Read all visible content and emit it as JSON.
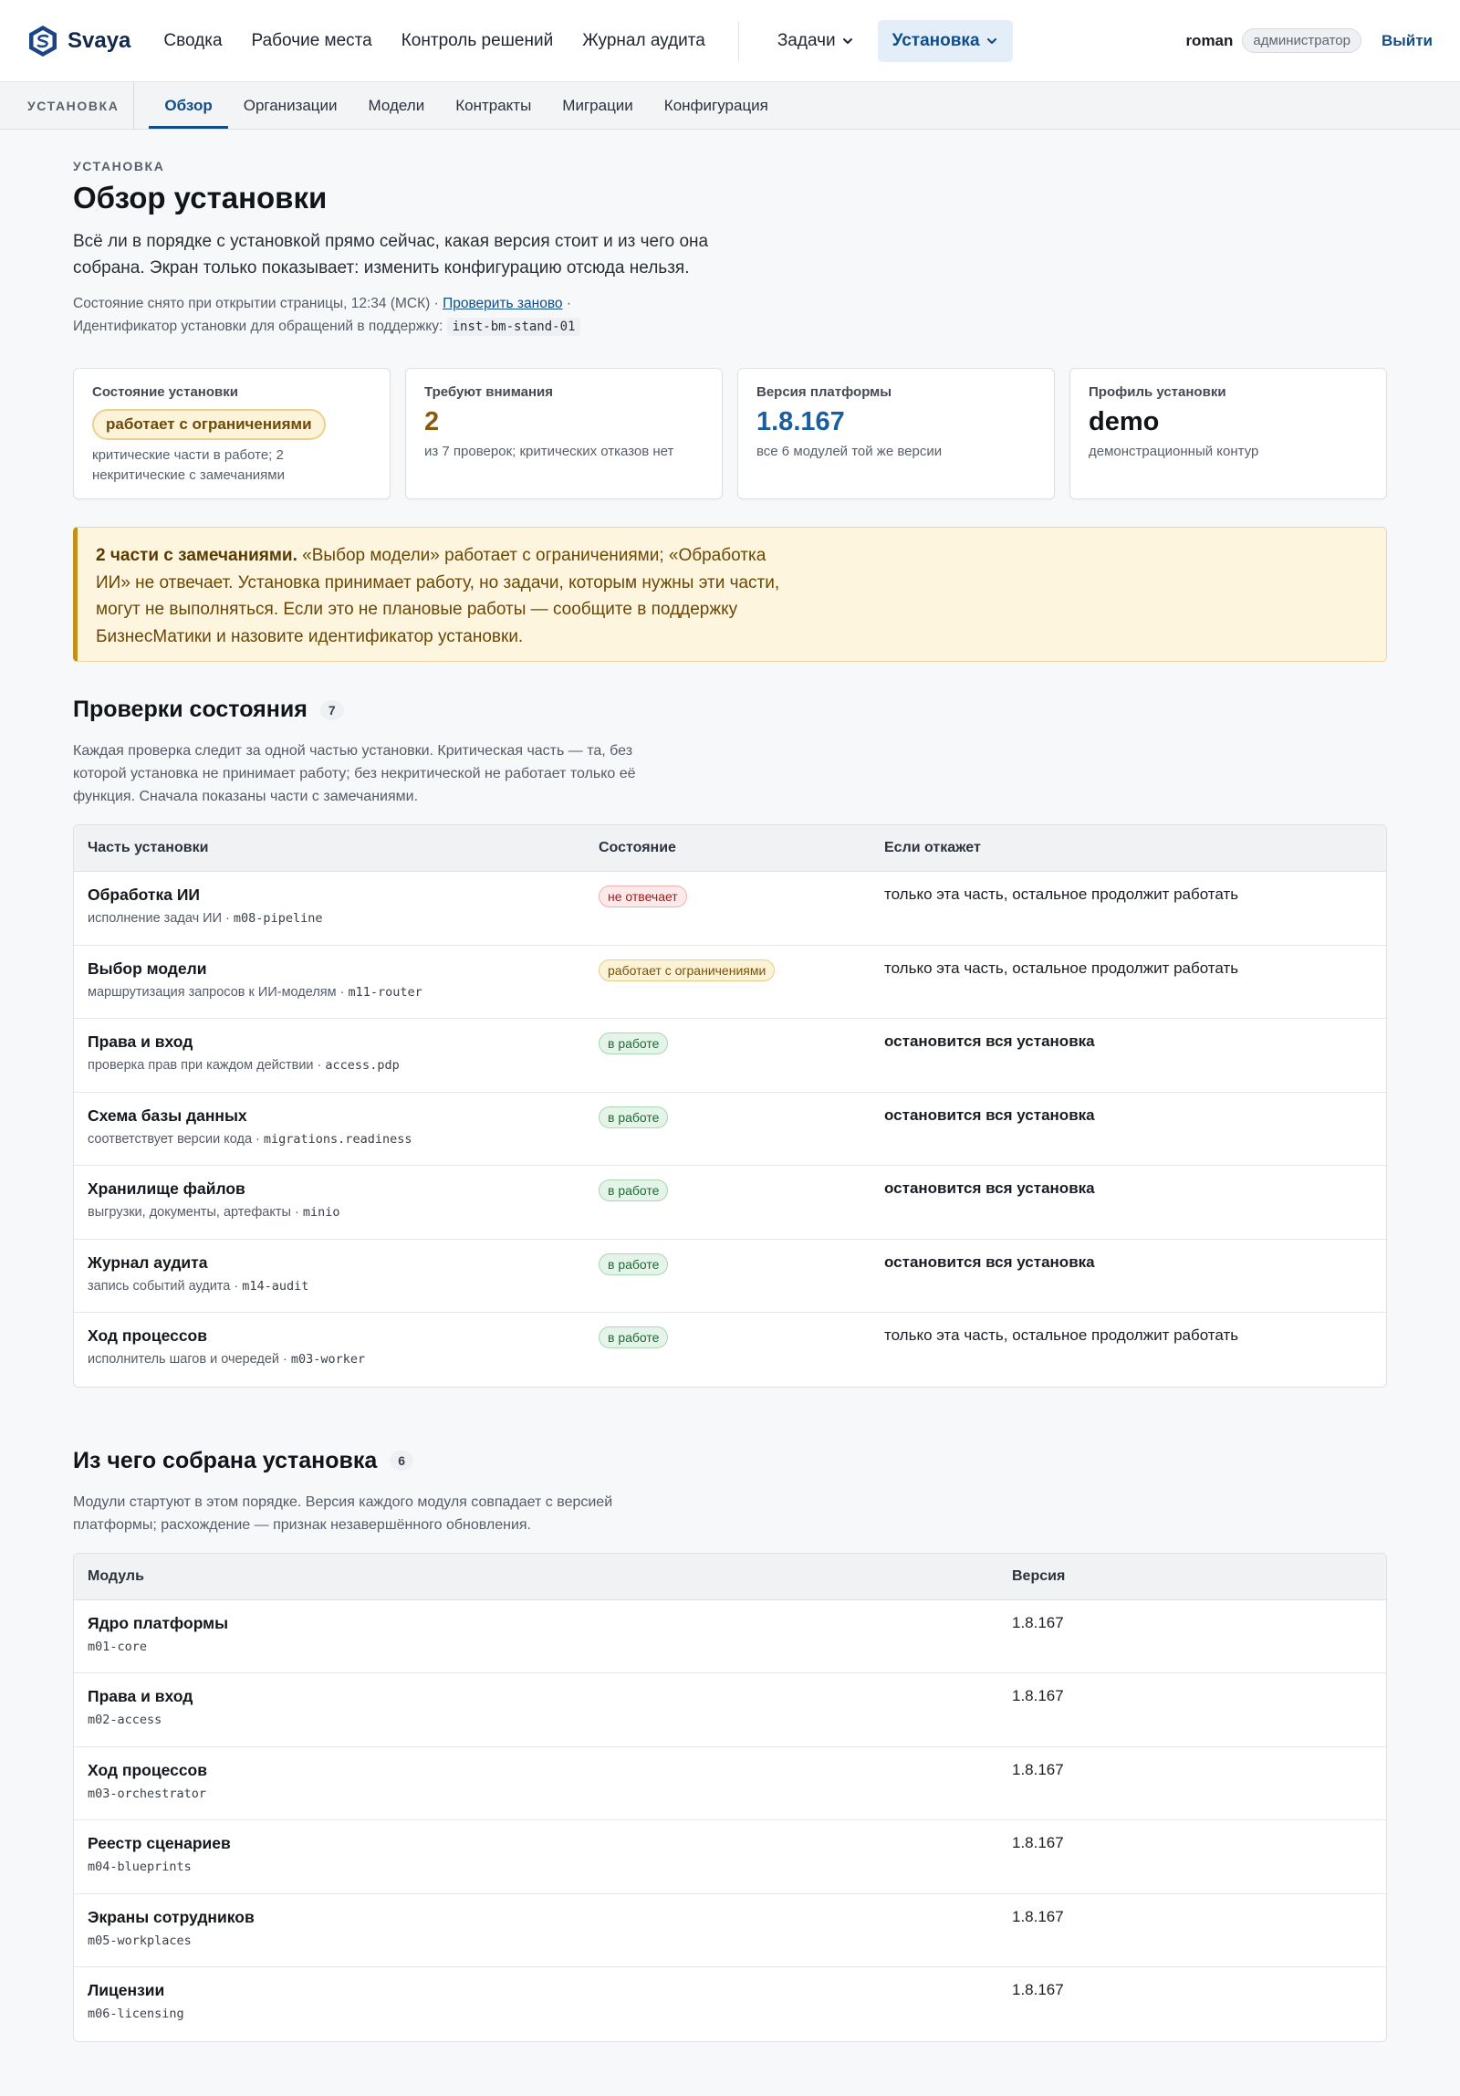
{
  "header": {
    "brand": "Svaya",
    "nav": [
      "Сводка",
      "Рабочие места",
      "Контроль решений",
      "Журнал аудита"
    ],
    "tasks_menu": "Задачи",
    "install_menu": "Установка",
    "user": "roman",
    "role": "администратор",
    "logout": "Выйти"
  },
  "subnav": {
    "section": "УСТАНОВКА",
    "tabs": [
      "Обзор",
      "Организации",
      "Модели",
      "Контракты",
      "Миграции",
      "Конфигурация"
    ],
    "active_tab": "Обзор"
  },
  "page": {
    "eyebrow": "УСТАНОВКА",
    "title": "Обзор установки",
    "lead": "Всё ли в порядке с установкой прямо сейчас, какая версия стоит и из чего она собрана. Экран только показывает: изменить конфигурацию отсюда нельзя.",
    "snapshot_text": "Состояние снято при открытии страницы, 12:34 (МСК) ·",
    "recheck_link": "Проверить заново",
    "snapshot_tail": "·",
    "support_id_label": "Идентификатор установки для обращений в поддержку:",
    "support_id": "inst-bm-stand-01"
  },
  "cards": {
    "status": {
      "label": "Состояние установки",
      "value": "работает с ограничениями",
      "sub": "критические части в работе; 2 некритические с замечаниями"
    },
    "attention": {
      "label": "Требуют внимания",
      "value": "2",
      "sub": "из 7 проверок; критических отказов нет"
    },
    "version": {
      "label": "Версия платформы",
      "value": "1.8.167",
      "sub": "все 6 модулей той же версии"
    },
    "profile": {
      "label": "Профиль установки",
      "value": "demo",
      "sub": "демонстрационный контур"
    }
  },
  "alert": {
    "title": "2 части с замечаниями.",
    "text": "«Выбор модели» работает с ограничениями; «Обработка ИИ» не отвечает. Установка принимает работу, но задачи, которым нужны эти части, могут не выполняться. Если это не плановые работы — сообщите в поддержку БизнесМатики и назовите идентификатор установки."
  },
  "checks": {
    "title": "Проверки состояния",
    "count": "7",
    "desc": "Каждая проверка следит за одной частью установки. Критическая часть — та, без которой установка не принимает работу; без некритической не работает только её функция. Сначала показаны части с замечаниями.",
    "columns": [
      "Часть установки",
      "Состояние",
      "Если откажет"
    ],
    "rows": [
      {
        "name": "Обработка ИИ",
        "desc": "исполнение задач ИИ ·",
        "code": "m08-pipeline",
        "status": "не отвечает",
        "impact": "только эта часть, остальное продолжит работать"
      },
      {
        "name": "Выбор модели",
        "desc": "маршрутизация запросов к ИИ-моделям ·",
        "code": "m11-router",
        "status": "работает с ограничениями",
        "impact": "только эта часть, остальное продолжит работать"
      },
      {
        "name": "Права и вход",
        "desc": "проверка прав при каждом действии ·",
        "code": "access.pdp",
        "status": "в работе",
        "impact": "остановится вся установка"
      },
      {
        "name": "Схема базы данных",
        "desc": "соответствует версии кода ·",
        "code": "migrations.readiness",
        "status": "в работе",
        "impact": "остановится вся установка"
      },
      {
        "name": "Хранилище файлов",
        "desc": "выгрузки, документы, артефакты ·",
        "code": "minio",
        "status": "в работе",
        "impact": "остановится вся установка"
      },
      {
        "name": "Журнал аудита",
        "desc": "запись событий аудита ·",
        "code": "m14-audit",
        "status": "в работе",
        "impact": "остановится вся установка"
      },
      {
        "name": "Ход процессов",
        "desc": "исполнитель шагов и очередей ·",
        "code": "m03-worker",
        "status": "в работе",
        "impact": "только эта часть, остальное продолжит работать"
      }
    ]
  },
  "modules": {
    "title": "Из чего собрана установка",
    "count": "6",
    "desc": "Модули стартуют в этом порядке. Версия каждого модуля совпадает с версией платформы; расхождение — признак незавершённого обновления.",
    "columns": [
      "Модуль",
      "Версия"
    ],
    "rows": [
      {
        "name": "Ядро платформы",
        "code": "m01-core",
        "version": "1.8.167"
      },
      {
        "name": "Права и вход",
        "code": "m02-access",
        "version": "1.8.167"
      },
      {
        "name": "Ход процессов",
        "code": "m03-orchestrator",
        "version": "1.8.167"
      },
      {
        "name": "Реестр сценариев",
        "code": "m04-blueprints",
        "version": "1.8.167"
      },
      {
        "name": "Экраны сотрудников",
        "code": "m05-workplaces",
        "version": "1.8.167"
      },
      {
        "name": "Лицензии",
        "code": "m06-licensing",
        "version": "1.8.167"
      }
    ]
  },
  "colors": {
    "brand": "#13284d",
    "accent": "#0f4e88",
    "warn": "#8a5a07",
    "ok": "#1f6a35",
    "bad": "#9b1c1c"
  }
}
